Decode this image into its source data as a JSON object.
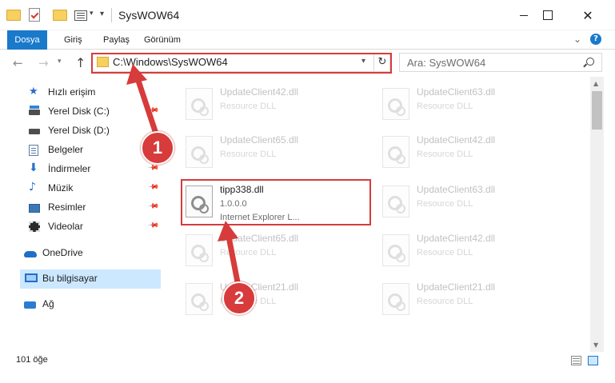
{
  "window": {
    "title": "SysWOW64"
  },
  "ribbon": {
    "tabs": [
      {
        "label": "Dosya"
      },
      {
        "label": "Giriş"
      },
      {
        "label": "Paylaş"
      },
      {
        "label": "Görünüm"
      }
    ],
    "help": "?"
  },
  "address_bar": {
    "path": "C:\\Windows\\SysWOW64"
  },
  "search": {
    "placeholder": "Ara: SysWOW64"
  },
  "sidebar": {
    "items": [
      {
        "label": "Hızlı erişim",
        "icon": "star-icon"
      },
      {
        "label": "Yerel Disk (C:)",
        "icon": "drive-icon",
        "pinned": true
      },
      {
        "label": "Yerel Disk (D:)",
        "icon": "drive-icon",
        "pinned": false
      },
      {
        "label": "Belgeler",
        "icon": "documents-icon",
        "pinned": true
      },
      {
        "label": "İndirmeler",
        "icon": "download-icon",
        "pinned": true
      },
      {
        "label": "Müzik",
        "icon": "music-icon",
        "pinned": true
      },
      {
        "label": "Resimler",
        "icon": "pictures-icon",
        "pinned": true
      },
      {
        "label": "Videolar",
        "icon": "videos-icon",
        "pinned": true
      },
      {
        "label": "OneDrive",
        "icon": "onedrive-icon"
      },
      {
        "label": "Bu bilgisayar",
        "icon": "computer-icon",
        "selected": true
      },
      {
        "label": "Ağ",
        "icon": "network-icon"
      }
    ]
  },
  "files": [
    {
      "name": "UpdateClient42.dll",
      "type": "Resource DLL"
    },
    {
      "name": "UpdateClient63.dll",
      "type": "Resource DLL"
    },
    {
      "name": "UpdateClient65.dll",
      "type": "Resource DLL"
    },
    {
      "name": "UpdateClient42.dll",
      "type": "Resource DLL"
    },
    {
      "name": "tipp338.dll",
      "version": "1.0.0.0",
      "description": "Internet Explorer L..."
    },
    {
      "name": "UpdateClient63.dll",
      "type": "Resource DLL"
    },
    {
      "name": "UpdateClient65.dll",
      "type": "Resource DLL"
    },
    {
      "name": "UpdateClient42.dll",
      "type": "Resource DLL"
    },
    {
      "name": "UpdateClient21.dll",
      "type": "Resource DLL"
    },
    {
      "name": "UpdateClient21.dll",
      "type": "Resource DLL"
    }
  ],
  "status_bar": {
    "item_count": "101 öğe"
  },
  "annotations": {
    "step1": "1",
    "step2": "2",
    "color": "#d73b3b"
  }
}
